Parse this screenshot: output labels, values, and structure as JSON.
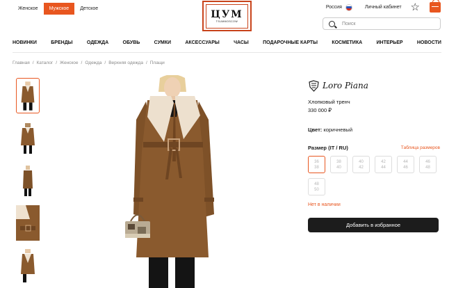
{
  "header": {
    "gender_tabs": [
      "Женское",
      "Мужское",
      "Детское"
    ],
    "active_tab_index": 1,
    "logo": {
      "letters": "ЦУМ",
      "subtitle": "TSUMMOSCOW"
    },
    "region": "Россия",
    "cabinet": "Личный кабинет",
    "search_placeholder": "Поиск",
    "accent_color": "#e8561f"
  },
  "nav": [
    "НОВИНКИ",
    "БРЕНДЫ",
    "ОДЕЖДА",
    "ОБУВЬ",
    "СУМКИ",
    "АКСЕССУАРЫ",
    "ЧАСЫ",
    "ПОДАРОЧНЫЕ КАРТЫ",
    "КОСМЕТИКА",
    "ИНТЕРЬЕР",
    "НОВОСТИ"
  ],
  "breadcrumb": [
    "Главная",
    "Каталог",
    "Женское",
    "Одежда",
    "Верхняя одежда",
    "Плащи"
  ],
  "product": {
    "brand": "Loro Piana",
    "name": "Хлопковый тренч",
    "price": "330 000 ₽",
    "color_label": "Цвет:",
    "color_value": "коричневый",
    "size_label": "Размер",
    "size_system": "(IT / RU)",
    "size_table": "Таблица размеров",
    "sizes": [
      {
        "it": "36",
        "ru": "38"
      },
      {
        "it": "38",
        "ru": "40"
      },
      {
        "it": "40",
        "ru": "42"
      },
      {
        "it": "42",
        "ru": "44"
      },
      {
        "it": "44",
        "ru": "46"
      },
      {
        "it": "46",
        "ru": "48"
      },
      {
        "it": "48",
        "ru": "50"
      }
    ],
    "selected_size_index": 0,
    "availability": "Нет в наличии",
    "favorite_button": "Добавить в избранное"
  }
}
